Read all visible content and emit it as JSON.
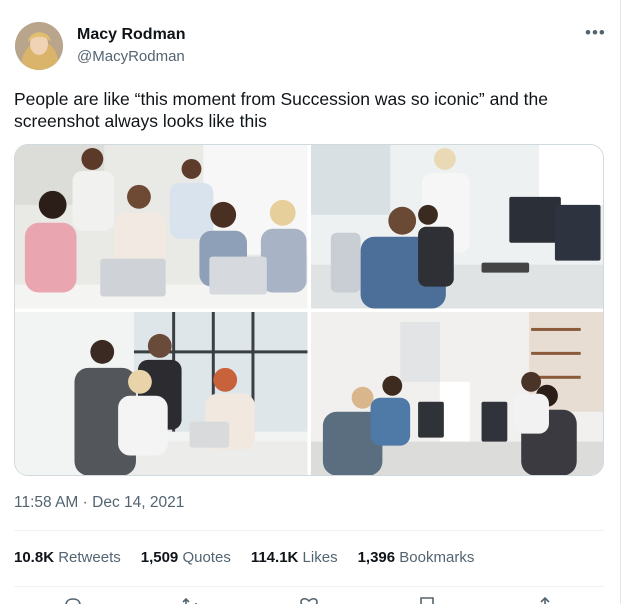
{
  "author": {
    "name": "Macy Rodman",
    "handle": "@MacyRodman",
    "avatar_icon": "profile-photo"
  },
  "tweet": {
    "text": "People are like “this moment from Succession was so iconic” and the screenshot always looks like this",
    "more_icon": "•••"
  },
  "media": [
    {
      "name": "stock-photo-team-laughing-at-laptops"
    },
    {
      "name": "stock-photo-coworkers-at-monitors"
    },
    {
      "name": "stock-photo-meeting-at-window-table"
    },
    {
      "name": "stock-photo-open-plan-office"
    }
  ],
  "meta": {
    "time": "11:58 AM",
    "separator": "·",
    "date": "Dec 14, 2021"
  },
  "stats": {
    "retweets": {
      "count": "10.8K",
      "label": "Retweets"
    },
    "quotes": {
      "count": "1,509",
      "label": "Quotes"
    },
    "likes": {
      "count": "114.1K",
      "label": "Likes"
    },
    "bookmarks": {
      "count": "1,396",
      "label": "Bookmarks"
    }
  },
  "actions": [
    "reply-icon",
    "retweet-icon",
    "like-icon",
    "bookmark-icon",
    "share-icon"
  ],
  "colors": {
    "text": "#0f1419",
    "secondary": "#536471",
    "border": "#cfd9de"
  }
}
